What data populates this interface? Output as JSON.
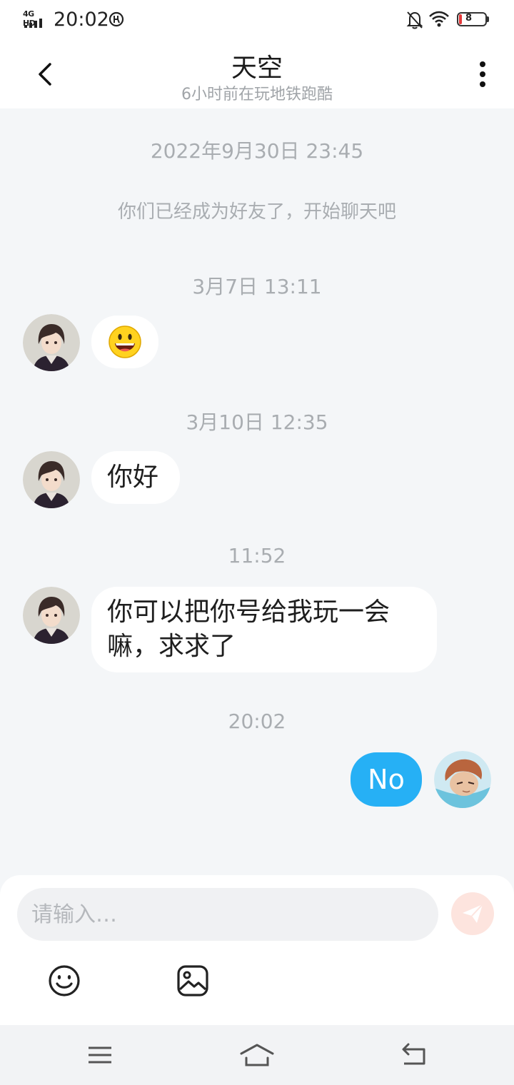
{
  "status_bar": {
    "network": "4G HD",
    "time": "20:02",
    "battery": "8",
    "icons": [
      "signal-icon",
      "vpn-icon",
      "bell-muted-icon",
      "wifi-icon",
      "battery-icon"
    ]
  },
  "header": {
    "title": "天空",
    "subtitle": "6小时前在玩地铁跑酷",
    "icons": [
      "chevron-left-icon",
      "more-vertical-icon"
    ]
  },
  "chat": {
    "system": {
      "time": "2022年9月30日 23:45",
      "text": "你们已经成为好友了，开始聊天吧"
    },
    "messages": [
      {
        "time": "3月7日 13:11",
        "from": "other",
        "content": "😃",
        "content_icon": "smiley-emoji-icon"
      },
      {
        "time": "3月10日 12:35",
        "from": "other",
        "content": "你好"
      },
      {
        "time": "11:52",
        "from": "other",
        "content": "你可以把你号给我玩一会嘛，求求了"
      },
      {
        "time": "20:02",
        "from": "me",
        "content": "No"
      }
    ]
  },
  "composer": {
    "placeholder": "请输入…",
    "value": "",
    "icons": [
      "send-icon",
      "emoji-icon",
      "image-icon"
    ]
  },
  "nav_bar": {
    "icons": [
      "menu-icon",
      "home-icon",
      "back-icon"
    ]
  },
  "colors": {
    "chat_background": "#f4f6f8",
    "my_bubble": "#26b0f5",
    "their_bubble": "#ffffff",
    "muted_text": "#a9adb1",
    "send_button": "#fde4de",
    "battery_low": "#e5393a"
  }
}
